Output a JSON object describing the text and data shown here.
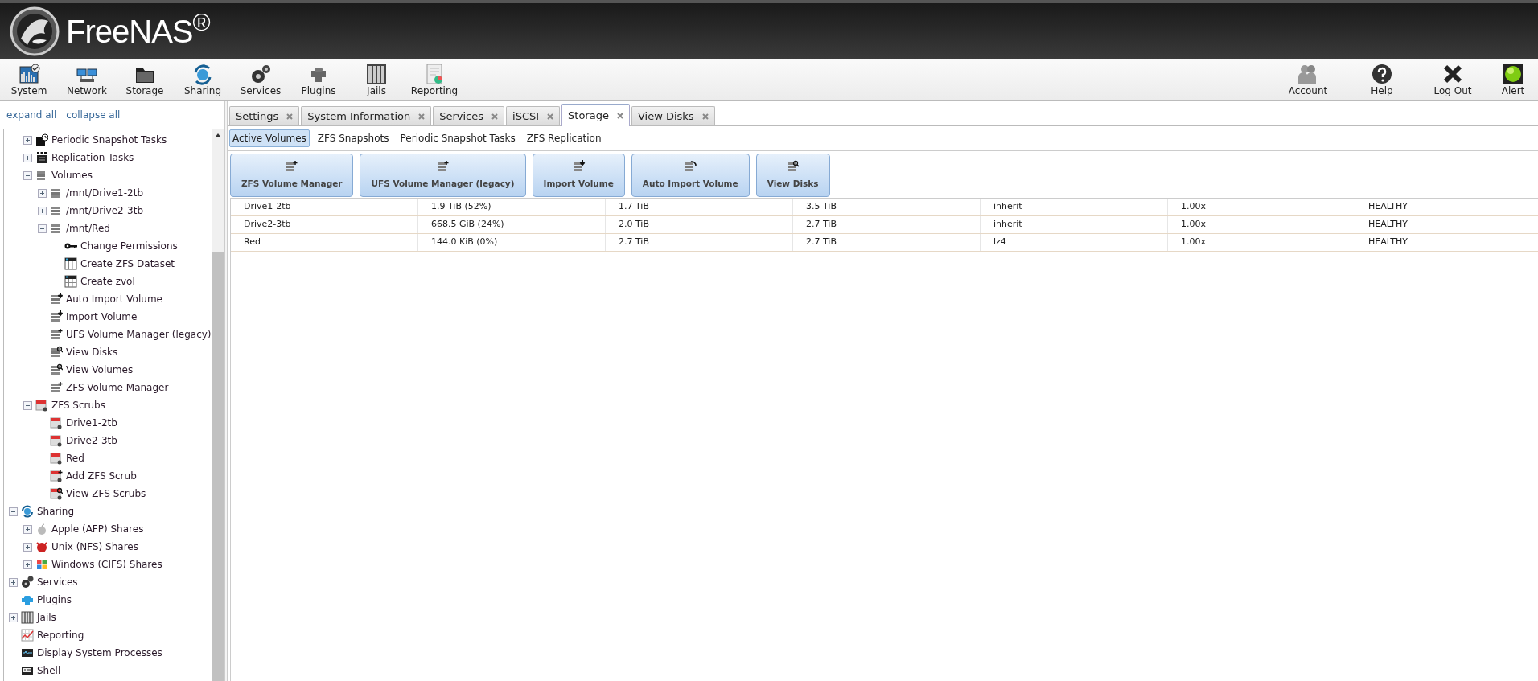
{
  "header": {
    "logo": "FreeNAS$^{®}$"
  },
  "toolbar": {
    "left": [
      "System",
      "Network",
      "Storage",
      "Sharing",
      "Services",
      "Plugins",
      "Jails",
      "Reporting"
    ],
    "right": [
      "Account",
      "Help",
      "Log Out",
      "Alert"
    ]
  },
  "sidebar": {
    "links": [
      "expand all",
      "collapse all"
    ],
    "tree": [
      {
        "children": [
          {
            "label": "Periodic Snapshot Tasks",
            "kind": "snapshot",
            "expanded": false
          },
          {
            "label": "Replication Tasks",
            "kind": "replication",
            "expanded": false
          },
          {
            "label": "Volumes",
            "kind": "volume",
            "expanded": true,
            "children": [
              {
                "label": "/mnt/Drive1-2tb",
                "kind": "volume",
                "expanded": false
              },
              {
                "label": "/mnt/Drive2-3tb",
                "kind": "volume",
                "expanded": false
              },
              {
                "label": "/mnt/Red",
                "kind": "volume",
                "expanded": true,
                "children": [
                  {
                    "label": "Change Permissions",
                    "kind": "key"
                  },
                  {
                    "label": "Create ZFS Dataset",
                    "kind": "grid"
                  },
                  {
                    "label": "Create zvol",
                    "kind": "grid"
                  }
                ]
              },
              {
                "label": "Auto Import Volume",
                "kind": "volume-import"
              },
              {
                "label": "Import Volume",
                "kind": "volume-import"
              },
              {
                "label": "UFS Volume Manager (legacy)",
                "kind": "volume-add"
              },
              {
                "label": "View Disks",
                "kind": "volume-search"
              },
              {
                "label": "View Volumes",
                "kind": "volume-search"
              },
              {
                "label": "ZFS Volume Manager",
                "kind": "volume-add"
              }
            ]
          },
          {
            "label": "ZFS Scrubs",
            "kind": "calendar",
            "expanded": true,
            "children": [
              {
                "label": "Drive1-2tb",
                "kind": "calendar"
              },
              {
                "label": "Drive2-3tb",
                "kind": "calendar"
              },
              {
                "label": "Red",
                "kind": "calendar"
              },
              {
                "label": "Add ZFS Scrub",
                "kind": "calendar-add"
              },
              {
                "label": "View ZFS Scrubs",
                "kind": "calendar-search"
              }
            ]
          }
        ]
      },
      {
        "label": "Sharing",
        "kind": "sharing",
        "expanded": true,
        "children": [
          {
            "label": "Apple (AFP) Shares",
            "kind": "apple",
            "expanded": false
          },
          {
            "label": "Unix (NFS) Shares",
            "kind": "bsd",
            "expanded": false
          },
          {
            "label": "Windows (CIFS) Shares",
            "kind": "windows",
            "expanded": false
          }
        ]
      },
      {
        "label": "Services",
        "kind": "gears",
        "expanded": false
      },
      {
        "label": "Plugins",
        "kind": "plugin"
      },
      {
        "label": "Jails",
        "kind": "jails",
        "expanded": false
      },
      {
        "label": "Reporting",
        "kind": "chart"
      },
      {
        "label": "Display System Processes",
        "kind": "monitor"
      },
      {
        "label": "Shell",
        "kind": "terminal"
      }
    ]
  },
  "tabs": [
    {
      "label": "Settings",
      "selected": false
    },
    {
      "label": "System Information",
      "selected": false
    },
    {
      "label": "Services",
      "selected": false
    },
    {
      "label": "iSCSI",
      "selected": false
    },
    {
      "label": "Storage",
      "selected": true
    },
    {
      "label": "View Disks",
      "selected": false
    }
  ],
  "subtabs": [
    {
      "label": "Active Volumes",
      "selected": true
    },
    {
      "label": "ZFS Snapshots",
      "selected": false
    },
    {
      "label": "Periodic Snapshot Tasks",
      "selected": false
    },
    {
      "label": "ZFS Replication",
      "selected": false
    }
  ],
  "actions": [
    {
      "label": "ZFS Volume Manager",
      "kind": "add"
    },
    {
      "label": "UFS Volume Manager (legacy)",
      "kind": "add"
    },
    {
      "label": "Import Volume",
      "kind": "import"
    },
    {
      "label": "Auto Import Volume",
      "kind": "refresh"
    },
    {
      "label": "View Disks",
      "kind": "search"
    }
  ],
  "table": {
    "rows": [
      [
        "Drive1-2tb",
        "1.9 TiB (52%)",
        "1.7 TiB",
        "3.5 TiB",
        "inherit",
        "1.00x",
        "HEALTHY"
      ],
      [
        "Drive2-3tb",
        "668.5 GiB (24%)",
        "2.0 TiB",
        "2.7 TiB",
        "inherit",
        "1.00x",
        "HEALTHY"
      ],
      [
        "Red",
        "144.0 KiB (0%)",
        "2.7 TiB",
        "2.7 TiB",
        "lz4",
        "1.00x",
        "HEALTHY"
      ]
    ]
  }
}
